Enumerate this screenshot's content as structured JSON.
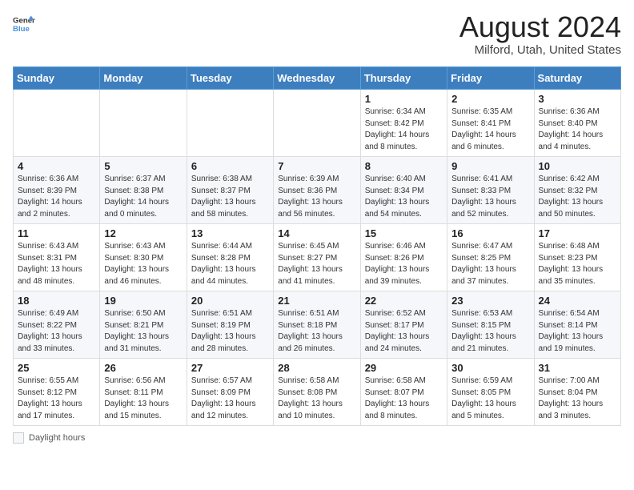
{
  "header": {
    "logo_line1": "General",
    "logo_line2": "Blue",
    "month_year": "August 2024",
    "location": "Milford, Utah, United States"
  },
  "days_of_week": [
    "Sunday",
    "Monday",
    "Tuesday",
    "Wednesday",
    "Thursday",
    "Friday",
    "Saturday"
  ],
  "weeks": [
    [
      {
        "day": "",
        "info": ""
      },
      {
        "day": "",
        "info": ""
      },
      {
        "day": "",
        "info": ""
      },
      {
        "day": "",
        "info": ""
      },
      {
        "day": "1",
        "info": "Sunrise: 6:34 AM\nSunset: 8:42 PM\nDaylight: 14 hours and 8 minutes."
      },
      {
        "day": "2",
        "info": "Sunrise: 6:35 AM\nSunset: 8:41 PM\nDaylight: 14 hours and 6 minutes."
      },
      {
        "day": "3",
        "info": "Sunrise: 6:36 AM\nSunset: 8:40 PM\nDaylight: 14 hours and 4 minutes."
      }
    ],
    [
      {
        "day": "4",
        "info": "Sunrise: 6:36 AM\nSunset: 8:39 PM\nDaylight: 14 hours and 2 minutes."
      },
      {
        "day": "5",
        "info": "Sunrise: 6:37 AM\nSunset: 8:38 PM\nDaylight: 14 hours and 0 minutes."
      },
      {
        "day": "6",
        "info": "Sunrise: 6:38 AM\nSunset: 8:37 PM\nDaylight: 13 hours and 58 minutes."
      },
      {
        "day": "7",
        "info": "Sunrise: 6:39 AM\nSunset: 8:36 PM\nDaylight: 13 hours and 56 minutes."
      },
      {
        "day": "8",
        "info": "Sunrise: 6:40 AM\nSunset: 8:34 PM\nDaylight: 13 hours and 54 minutes."
      },
      {
        "day": "9",
        "info": "Sunrise: 6:41 AM\nSunset: 8:33 PM\nDaylight: 13 hours and 52 minutes."
      },
      {
        "day": "10",
        "info": "Sunrise: 6:42 AM\nSunset: 8:32 PM\nDaylight: 13 hours and 50 minutes."
      }
    ],
    [
      {
        "day": "11",
        "info": "Sunrise: 6:43 AM\nSunset: 8:31 PM\nDaylight: 13 hours and 48 minutes."
      },
      {
        "day": "12",
        "info": "Sunrise: 6:43 AM\nSunset: 8:30 PM\nDaylight: 13 hours and 46 minutes."
      },
      {
        "day": "13",
        "info": "Sunrise: 6:44 AM\nSunset: 8:28 PM\nDaylight: 13 hours and 44 minutes."
      },
      {
        "day": "14",
        "info": "Sunrise: 6:45 AM\nSunset: 8:27 PM\nDaylight: 13 hours and 41 minutes."
      },
      {
        "day": "15",
        "info": "Sunrise: 6:46 AM\nSunset: 8:26 PM\nDaylight: 13 hours and 39 minutes."
      },
      {
        "day": "16",
        "info": "Sunrise: 6:47 AM\nSunset: 8:25 PM\nDaylight: 13 hours and 37 minutes."
      },
      {
        "day": "17",
        "info": "Sunrise: 6:48 AM\nSunset: 8:23 PM\nDaylight: 13 hours and 35 minutes."
      }
    ],
    [
      {
        "day": "18",
        "info": "Sunrise: 6:49 AM\nSunset: 8:22 PM\nDaylight: 13 hours and 33 minutes."
      },
      {
        "day": "19",
        "info": "Sunrise: 6:50 AM\nSunset: 8:21 PM\nDaylight: 13 hours and 31 minutes."
      },
      {
        "day": "20",
        "info": "Sunrise: 6:51 AM\nSunset: 8:19 PM\nDaylight: 13 hours and 28 minutes."
      },
      {
        "day": "21",
        "info": "Sunrise: 6:51 AM\nSunset: 8:18 PM\nDaylight: 13 hours and 26 minutes."
      },
      {
        "day": "22",
        "info": "Sunrise: 6:52 AM\nSunset: 8:17 PM\nDaylight: 13 hours and 24 minutes."
      },
      {
        "day": "23",
        "info": "Sunrise: 6:53 AM\nSunset: 8:15 PM\nDaylight: 13 hours and 21 minutes."
      },
      {
        "day": "24",
        "info": "Sunrise: 6:54 AM\nSunset: 8:14 PM\nDaylight: 13 hours and 19 minutes."
      }
    ],
    [
      {
        "day": "25",
        "info": "Sunrise: 6:55 AM\nSunset: 8:12 PM\nDaylight: 13 hours and 17 minutes."
      },
      {
        "day": "26",
        "info": "Sunrise: 6:56 AM\nSunset: 8:11 PM\nDaylight: 13 hours and 15 minutes."
      },
      {
        "day": "27",
        "info": "Sunrise: 6:57 AM\nSunset: 8:09 PM\nDaylight: 13 hours and 12 minutes."
      },
      {
        "day": "28",
        "info": "Sunrise: 6:58 AM\nSunset: 8:08 PM\nDaylight: 13 hours and 10 minutes."
      },
      {
        "day": "29",
        "info": "Sunrise: 6:58 AM\nSunset: 8:07 PM\nDaylight: 13 hours and 8 minutes."
      },
      {
        "day": "30",
        "info": "Sunrise: 6:59 AM\nSunset: 8:05 PM\nDaylight: 13 hours and 5 minutes."
      },
      {
        "day": "31",
        "info": "Sunrise: 7:00 AM\nSunset: 8:04 PM\nDaylight: 13 hours and 3 minutes."
      }
    ]
  ],
  "legend": {
    "box_label": "Daylight hours"
  }
}
